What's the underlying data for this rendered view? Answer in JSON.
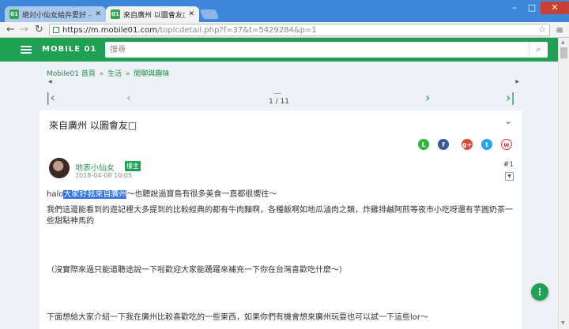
{
  "browser": {
    "tabs": [
      {
        "label": "絶対小仙女給弁愛好 - 閑聊"
      },
      {
        "label": "來自廣州 以圖會友□ - 閑"
      }
    ],
    "url_host": "https://m.mobile01.com",
    "url_rest": "/topicdetail.php?f=37&t=5429284&p=1"
  },
  "header": {
    "logo": "MOBILE 01",
    "search_placeholder": "搜尋"
  },
  "breadcrumb": {
    "items": [
      "Mobile01 首頁",
      "生活",
      "閒聊與趣味"
    ],
    "separator": "»"
  },
  "pager": {
    "dots": "......",
    "count": "1 / 11"
  },
  "topic": {
    "title": "來自廣州 以圖會友□"
  },
  "post": {
    "author": "地表小仙女",
    "role": "樓主",
    "date": "2018-04-08 10:05",
    "floor": "#1",
    "p1_before": "halo",
    "p1_highlight": "大家好我來自廣州",
    "p1_after": "～也聽說過寶島有很多美食一直都很嚮往～",
    "p2": "我們這邊能看到的遊記裡大多提到的比較經典的都有牛肉麵啊，各種飯啊如地瓜滷肉之類，炸雞排鹹阿煎等夜市小吃呀還有芋圓奶茶一些甜點神馬的",
    "p3": "（沒實際來過只能道聽途說一下啦歡迎大家能踴躍來補充一下你在台灣喜歡吃什麼～）",
    "p4": "下面想給大家介紹一下我在廣州比較喜歡吃的一些東西，如果你們有機會想來廣州玩耍也可以試一下這些lor～"
  },
  "colors": {
    "brand": "#1ea152",
    "tabbar": "#3c87d9"
  }
}
